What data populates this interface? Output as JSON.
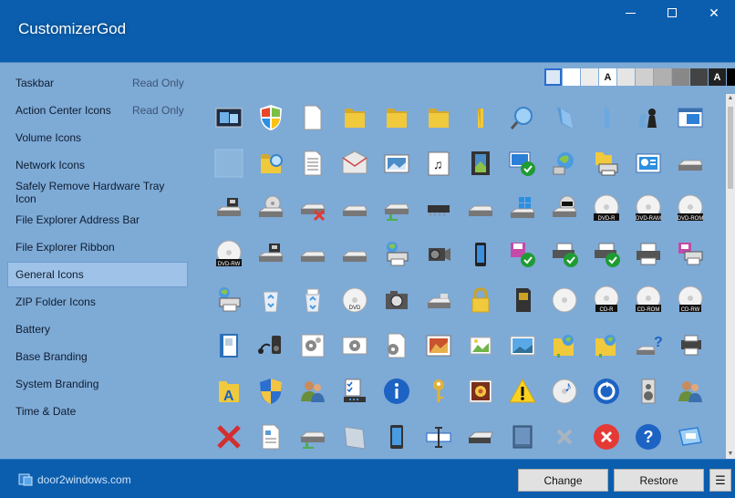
{
  "app": {
    "title": "CustomizerGod"
  },
  "window": {
    "minimize": "—",
    "maximize": "☐",
    "close": "✕"
  },
  "sidebar": {
    "items": [
      {
        "label": "Taskbar",
        "badge": "Read Only"
      },
      {
        "label": "Action Center Icons",
        "badge": "Read Only"
      },
      {
        "label": "Volume Icons",
        "badge": ""
      },
      {
        "label": "Network Icons",
        "badge": ""
      },
      {
        "label": "Safely Remove Hardware Tray Icon",
        "badge": ""
      },
      {
        "label": "File Explorer Address Bar",
        "badge": ""
      },
      {
        "label": "File Explorer Ribbon",
        "badge": ""
      },
      {
        "label": "General Icons",
        "badge": ""
      },
      {
        "label": "ZIP Folder Icons",
        "badge": ""
      },
      {
        "label": "Battery",
        "badge": ""
      },
      {
        "label": "Base Branding",
        "badge": ""
      },
      {
        "label": "System Branding",
        "badge": ""
      },
      {
        "label": "Time & Date",
        "badge": ""
      }
    ],
    "selected_index": 7
  },
  "swatches": [
    {
      "color": "#dbe9f7",
      "label": "",
      "selected": true
    },
    {
      "color": "#ffffff",
      "label": ""
    },
    {
      "color": "#ededed",
      "label": ""
    },
    {
      "color": "#ffffff",
      "label": "A",
      "text": "#111111"
    },
    {
      "color": "#e5e5e5",
      "label": ""
    },
    {
      "color": "#cfcfcf",
      "label": ""
    },
    {
      "color": "#b0b0b0",
      "label": ""
    },
    {
      "color": "#888888",
      "label": ""
    },
    {
      "color": "#444444",
      "label": ""
    },
    {
      "color": "#222222",
      "label": "A",
      "text": "#ffffff"
    },
    {
      "color": "#000000",
      "label": ""
    }
  ],
  "icons": [
    [
      "display-icon",
      "windows-shield-icon",
      "blank-document-icon",
      "folder-icon",
      "folder-icon",
      "folder-icon",
      "folder-narrow-icon",
      "search-globe-icon",
      "open-folder-blue-icon",
      "folder-blue-narrow-icon",
      "chess-icon",
      "window-panel-icon"
    ],
    [
      "empty-slot-icon",
      "folder-search-icon",
      "text-document-icon",
      "email-icon",
      "picture-icon",
      "music-document-icon",
      "video-film-icon",
      "check-screen-icon",
      "network-globe-icon",
      "printer-folder-icon",
      "control-panel-icon",
      "drive-icon"
    ],
    [
      "floppy-drive-icon",
      "cd-drive-icon",
      "drive-error-icon",
      "drive-icon",
      "network-drive-icon",
      "chip-icon",
      "drive-icon",
      "windows-drive-icon",
      "dvd-drive-icon",
      "dvd-r-disc-icon",
      "dvd-ram-disc-icon",
      "dvd-rom-disc-icon"
    ],
    [
      "dvd-rw-disc-icon",
      "floppy-drive-icon",
      "drive-icon",
      "drive-icon",
      "printer-network-icon",
      "camcorder-icon",
      "phone-icon",
      "floppy-check-icon",
      "printer-check-icon",
      "printer-check-icon",
      "printer-icon",
      "printer-pink-icon"
    ],
    [
      "printer-network-icon",
      "recycle-bin-empty-icon",
      "recycle-bin-full-icon",
      "dvd-disc-icon",
      "camera-icon",
      "drive-light-icon",
      "lock-icon",
      "sd-card-icon",
      "cd-disc-icon",
      "cd-r-disc-icon",
      "cd-rom-disc-icon",
      "cd-rw-disc-icon"
    ],
    [
      "book-icon",
      "mp3-player-icon",
      "gears-icon",
      "gear-document-icon",
      "gear-icon",
      "image-frame-icon",
      "pictures-icon",
      "landscape-icon",
      "network-folder-icon",
      "network-folder-icon",
      "help-drive-icon",
      "printer-fax-icon"
    ],
    [
      "font-folder-icon",
      "security-shield-icon",
      "users-icon",
      "checklist-icon",
      "info-icon",
      "key-icon",
      "photo-flower-icon",
      "warning-icon",
      "music-cd-icon",
      "sync-icon",
      "speakers-icon",
      "users-icon"
    ],
    [
      "error-x-icon",
      "document-icon",
      "network-drive-icon",
      "window-icon",
      "mobile-device-icon",
      "ime-cursor-icon",
      "scanner-icon",
      "tablet-icon",
      "close-x-icon",
      "error-circle-icon",
      "help-circle-icon",
      "window-stack-icon"
    ]
  ],
  "footer": {
    "link": "door2windows.com",
    "change": "Change",
    "restore": "Restore",
    "menu": "☰"
  }
}
